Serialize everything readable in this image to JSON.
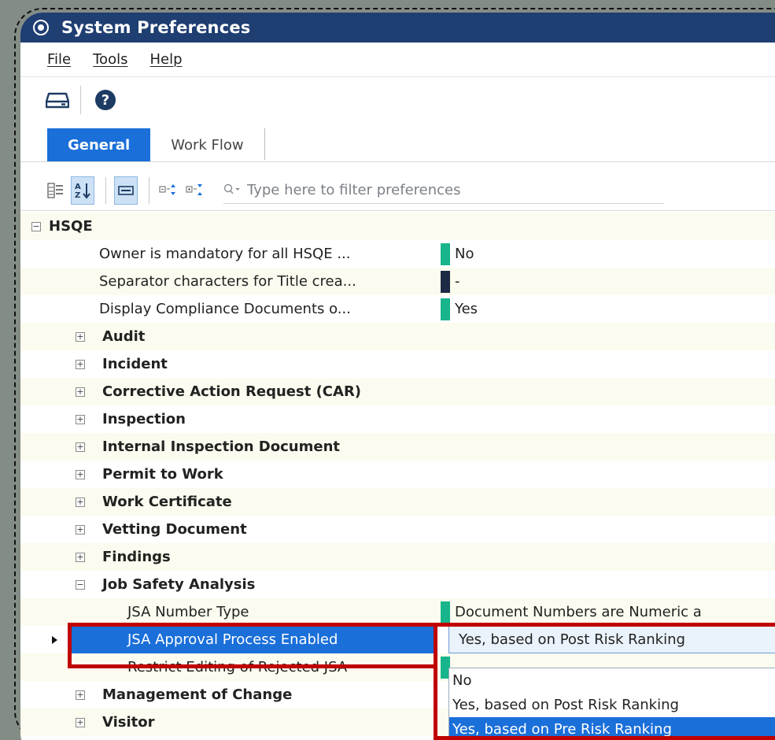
{
  "window": {
    "title": "System Preferences"
  },
  "menu": [
    "File",
    "Tools",
    "Help"
  ],
  "toolbar": {
    "icons": [
      "drive-icon",
      "help-icon"
    ],
    "help_glyph": "?"
  },
  "tabs": [
    {
      "label": "General",
      "active": true
    },
    {
      "label": "Work Flow",
      "active": false
    }
  ],
  "filter": {
    "placeholder": "Type here to filter preferences",
    "icons": [
      "categorized-icon",
      "alphabetical-sort-icon",
      "property-pages-icon",
      "expand-all-icon",
      "collapse-all-icon",
      "search-dropdown-icon"
    ]
  },
  "grid": {
    "hsqe": {
      "label": "HSQE",
      "props": [
        {
          "label": "Owner is mandatory for all HSQE ...",
          "value": "No",
          "mark": "#18b58c"
        },
        {
          "label": "Separator characters for Title crea...",
          "value": "-",
          "mark": "#1d2a44"
        },
        {
          "label": "Display Compliance Documents o...",
          "value": "Yes",
          "mark": "#18b58c"
        }
      ]
    },
    "categories": [
      "Audit",
      "Incident",
      "Corrective Action Request (CAR)",
      "Inspection",
      "Internal Inspection Document",
      "Permit to Work",
      "Work Certificate",
      "Vetting Document",
      "Findings"
    ],
    "jsa": {
      "label": "Job Safety Analysis",
      "number_type": {
        "label": "JSA Number Type",
        "value": "Document Numbers are Numeric a",
        "mark": "#18b58c"
      },
      "approval": {
        "label": "JSA Approval Process Enabled",
        "value": "Yes, based on Post Risk Ranking"
      },
      "restrict": {
        "label": "Restrict Editing of Rejected JSA",
        "mark": "#18b58c"
      }
    },
    "after": [
      "Management of Change",
      "Visitor"
    ]
  },
  "dropdown": {
    "options": [
      "No",
      "Yes, based on Post Risk Ranking",
      "Yes, based on Pre Risk Ranking"
    ],
    "highlighted": "Yes, based on Pre Risk Ranking"
  },
  "colors": {
    "accent": "#1a6fd9",
    "titlebar": "#1f3e72",
    "highlight_border": "#c00000",
    "green_mark": "#18b58c",
    "row_alt": "#fbfbef"
  }
}
